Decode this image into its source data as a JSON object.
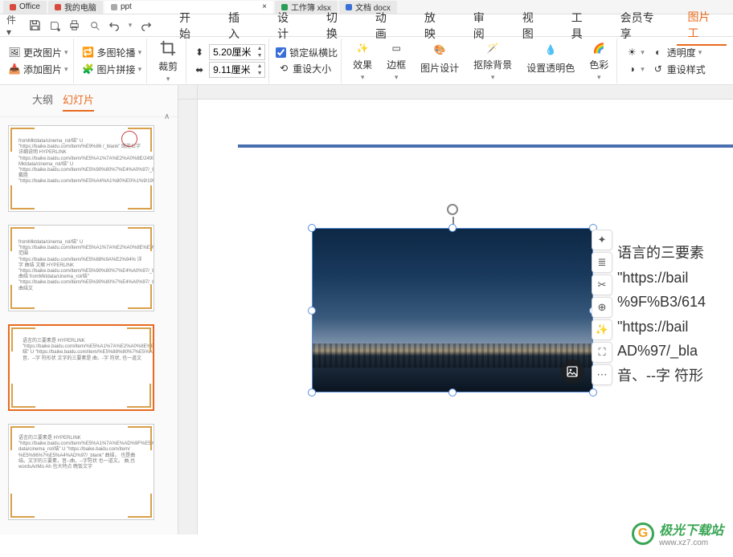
{
  "tabs": [
    {
      "label": "Office"
    },
    {
      "label": "我的电脑"
    },
    {
      "label": "ppt"
    },
    {
      "label": "工作簿 xlsx"
    },
    {
      "label": "文档 docx"
    }
  ],
  "menu": {
    "items": [
      "开始",
      "插入",
      "设计",
      "切换",
      "动画",
      "放映",
      "审阅",
      "视图",
      "工具",
      "会员专享",
      "图片工"
    ],
    "active": "图片工"
  },
  "ribbon": {
    "change_img": "更改图片",
    "multi_carousel": "多图轮播",
    "add_img": "添加图片",
    "img_stitch": "图片拼接",
    "crop": "裁剪",
    "width_val": "5.20厘米",
    "height_val": "9.11厘米",
    "lock_ratio": "锁定纵横比",
    "reset_size": "重设大小",
    "effect": "效果",
    "border": "边框",
    "img_design": "图片设计",
    "remove_bg": "抠除背景",
    "set_trans": "设置透明色",
    "color": "色彩",
    "opacity": "透明度",
    "reset_style": "重设样式"
  },
  "side": {
    "tabs": [
      "大纲",
      "幻灯片"
    ],
    "active": "幻灯片"
  },
  "thumbs": {
    "t1": "fromMktdata/cinema_rol/结\" U\n\"https://baike.baidu.com/item/%E9%86 /_blank\" 既能公字 详细说明 HYPERLINK\n\"https://baike.baidu.com/item/%E5%A1%7A%E2%A0%8E/24901575/from Mktdata/cinema_rol/结\" U\n\"https://baike.baidu.com/item/%E5%90%80%7%E4%A0%97/_blank\" 戴胜\n\"https://baike.baidu.com/item/%E5%A4%A1%80%E0%1%9/1992705\"",
    "t2": "fromMktdata/cinema_rol/结\" U\n\"https://baike.baidu.com/item/%E5%A1%7A%E2%A0%8E%E4%A2%7/_blank\" 范围\n\"https://baike.baidu.com/item/%E5%88%9A%E2%94% 详字 曲结\n文献 HYPERLINK\n\"https://baike.baidu.com/item/%E5%90%80%7%E4%A0%97/_blank\" 曲结\nfromMktdata/cinema_rol/结\"\n\"https://baike.baidu.com/item/%E5%90%80%7%E4%A0%97/_blank\" 曲结文",
    "t3": "语言的三要素是 HYPERLINK\n\"https://baike.baidu.com/item/%E5%A1%7A%E2%A0%8E%E5%9F%B3/61451177/fromMktdata/cinema_rol/结\" U\n\"https://baike.baidu.com/item/%E5%88%80%7%E5%A4%AD%97/_blank\" 曲结，文字的三要素是，音、--字 符形状 文字的三要素是\n曲、-字 符状, 也一道文",
    "t4": "语言的三要素是 HYPERLINK\n\"https://baike.baidu.com/item/%E5%A1%7A%E%AD%9F%E5%9F%B3/61451177/fromMkt\ndata/cinema_rol/结\" U\n\"https://baike.baidu.com/item/ %E5%96%7%E5%A4%AD%97/_blank\" 曲结，\n也是曲结。文字的三要素，音--曲、--字符状 也一道文。\n曲,也wordsArtMo\nAh 也大特点\n晚饭文字"
  },
  "bodytext": "语言的三要素\n\"https://bail\n%9F%B3/614\n\"https://bail\nAD%97/_bla\n音、--字 符形",
  "watermark": {
    "badge": "G",
    "text": "极光下载站",
    "sub": "www.xz7.com"
  }
}
